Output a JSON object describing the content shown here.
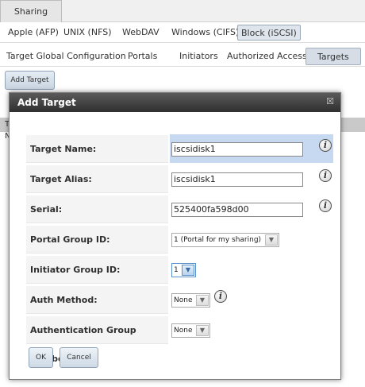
{
  "top_tab": {
    "label": "Sharing"
  },
  "sharing_tabs": [
    "Apple (AFP)",
    "UNIX (NFS)",
    "WebDAV",
    "Windows (CIFS)",
    "Block (iSCSI)"
  ],
  "iscsi_tabs": [
    "Target Global Configuration",
    "Portals",
    "Initiators",
    "Authorized Access",
    "Targets"
  ],
  "add_target_button": "Add Target",
  "background_letters": {
    "t": "T",
    "n": "N"
  },
  "dialog": {
    "title": "Add Target",
    "close_icon": "☒",
    "fields": {
      "target_name": {
        "label": "Target Name:",
        "value": "iscsidisk1"
      },
      "target_alias": {
        "label": "Target Alias:",
        "value": "iscsidisk1"
      },
      "serial": {
        "label": "Serial:",
        "value": "525400fa598d00"
      },
      "portal_group": {
        "label": "Portal Group ID:",
        "value": "1 (Portal for my sharing)"
      },
      "initiator_group": {
        "label": "Initiator Group ID:",
        "value": "1"
      },
      "auth_method": {
        "label": "Auth Method:",
        "value": "None"
      },
      "auth_group": {
        "label": "Authentication Group number:",
        "value": "None"
      }
    },
    "info_icon_glyph": "i",
    "ok_label": "OK",
    "cancel_label": "Cancel"
  },
  "colors": {
    "highlight": "#c7d9f1",
    "titlebar": "#3d3d3d"
  }
}
